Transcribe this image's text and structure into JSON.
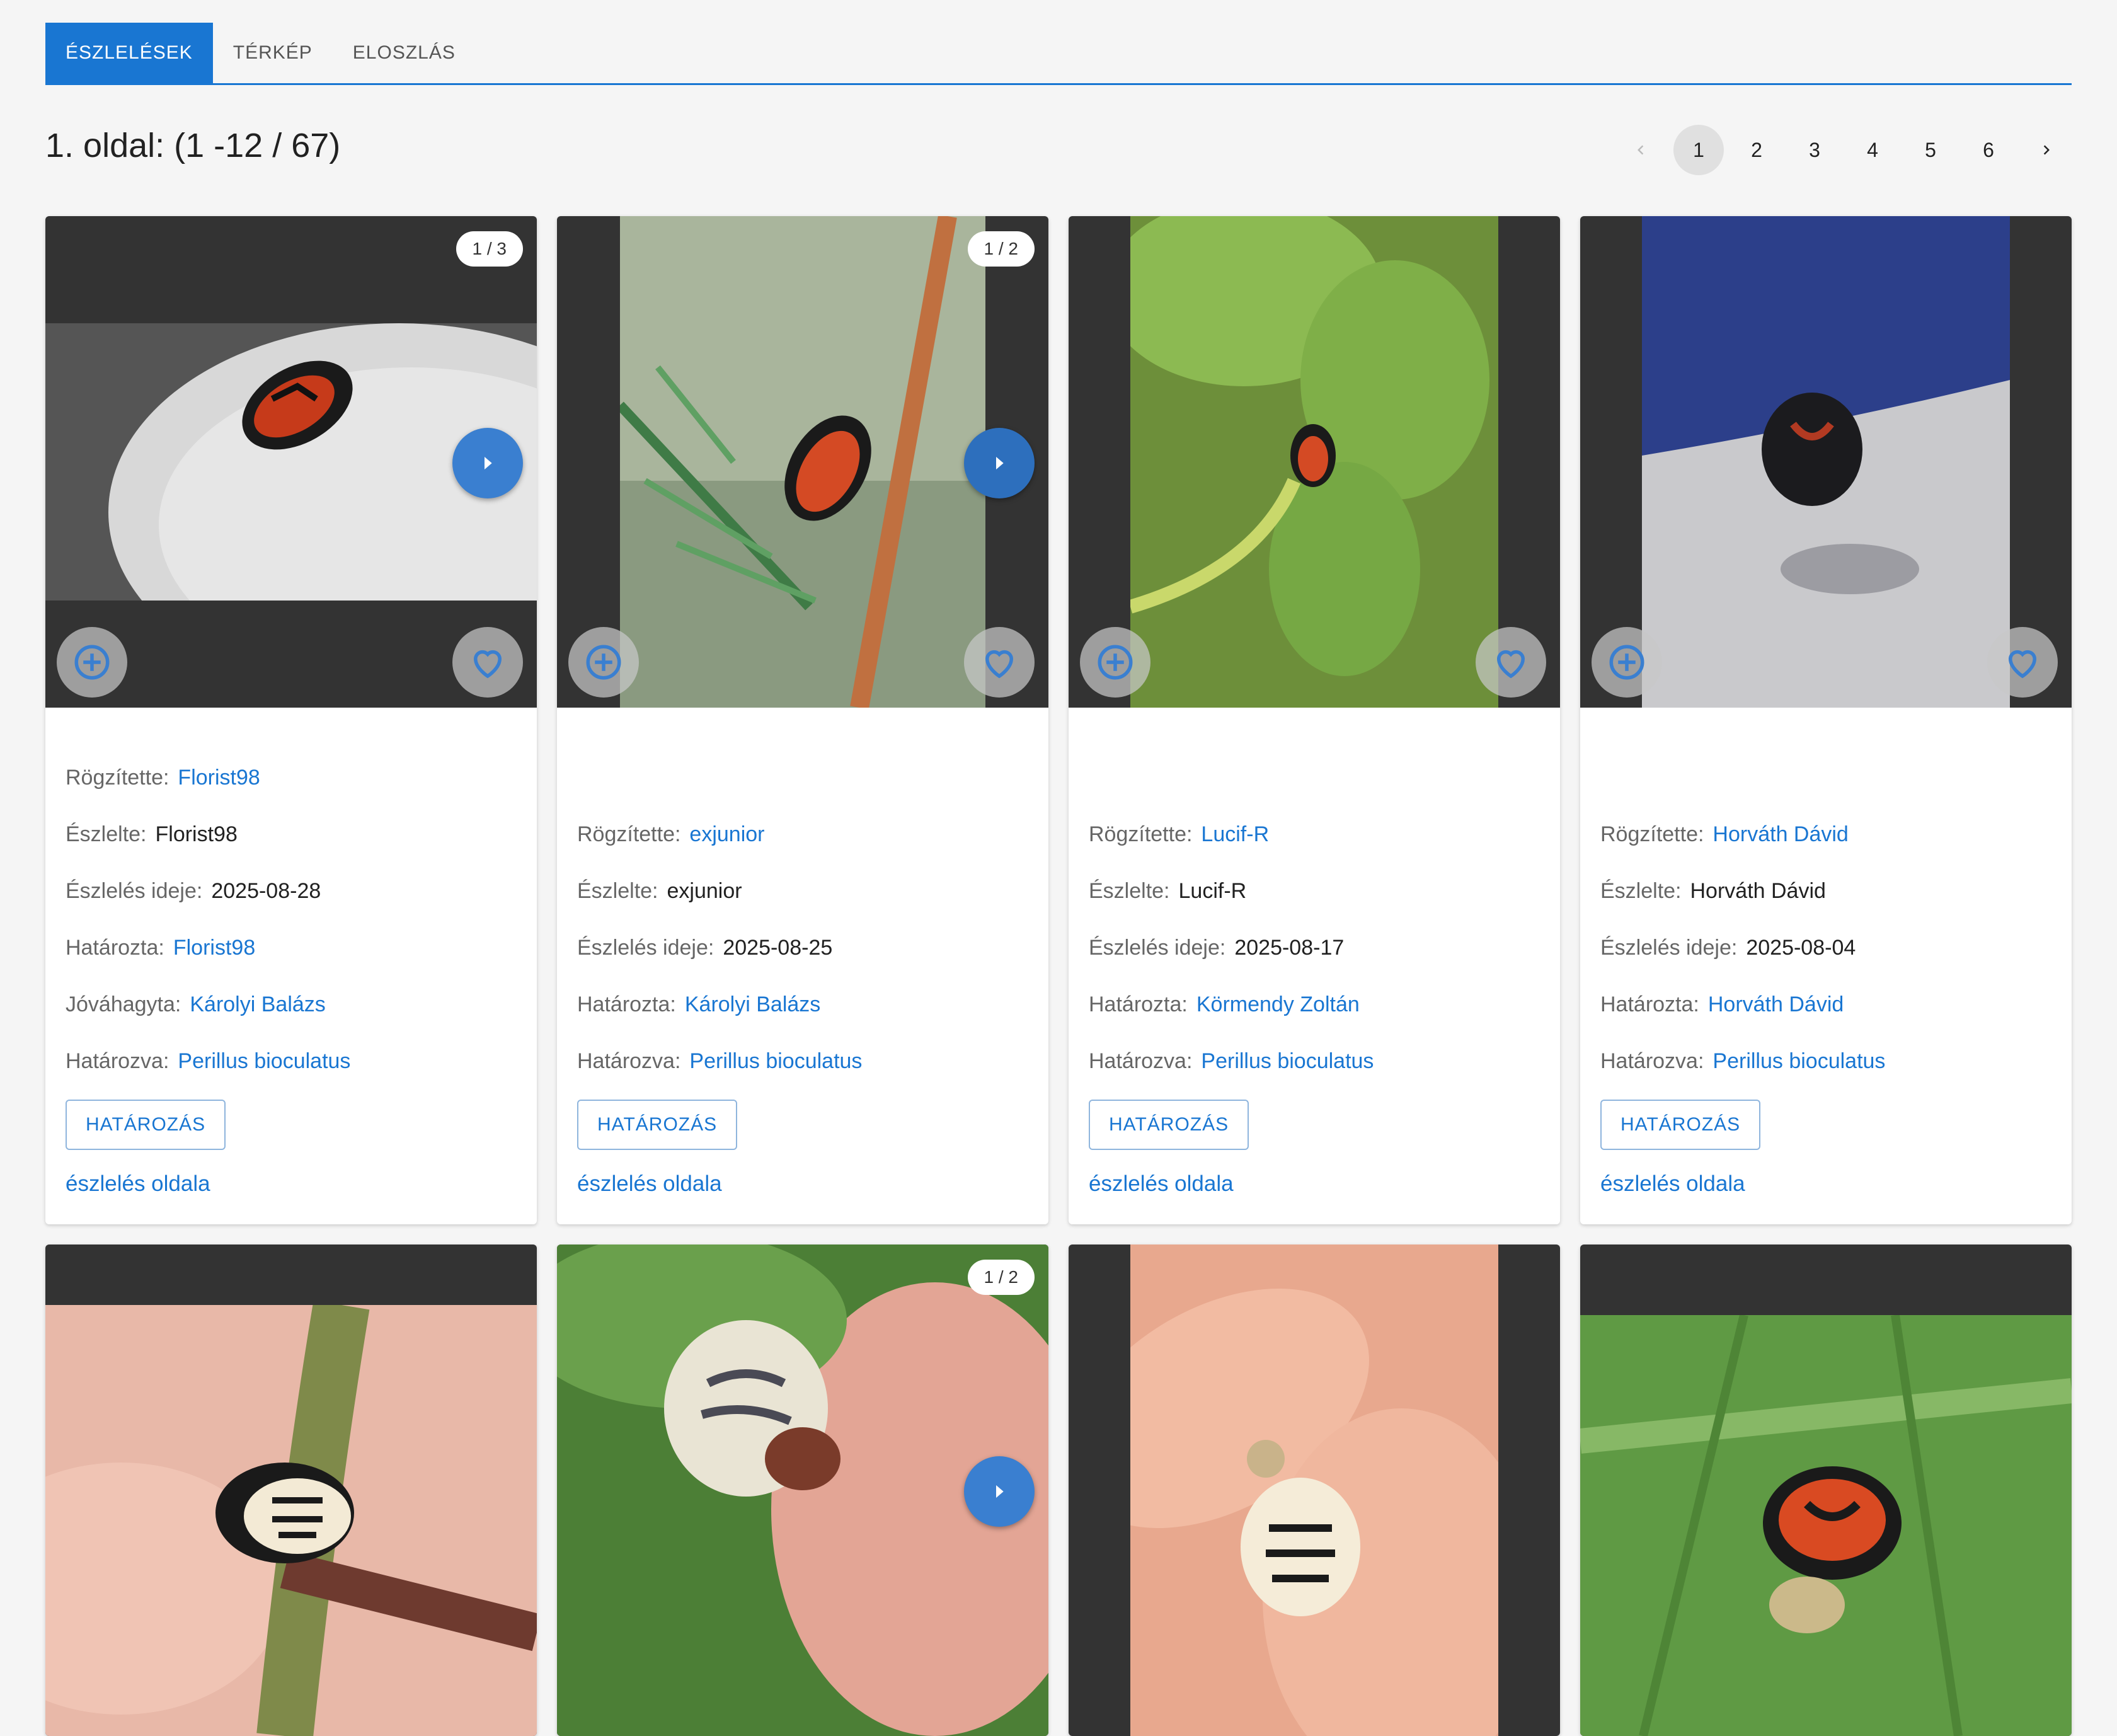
{
  "tabs": [
    {
      "label": "ÉSZLELÉSEK",
      "active": true
    },
    {
      "label": "TÉRKÉP",
      "active": false
    },
    {
      "label": "ELOSZLÁS",
      "active": false
    }
  ],
  "page_title": "1. oldal: (1 -12 / 67)",
  "pagination": {
    "pages": [
      "1",
      "2",
      "3",
      "4",
      "5",
      "6"
    ],
    "current": "1",
    "prev_icon": "chevron-left-icon",
    "next_icon": "chevron-right-icon"
  },
  "labels": {
    "recorded_by": "Rögzítette:",
    "observed_by": "Észlelte:",
    "observed_date": "Észlelés ideje:",
    "identified_by": "Határozta:",
    "approved_by": "Jóváhagyta:",
    "identified_as": "Határozva:",
    "identify_button": "HATÁROZÁS",
    "obs_page_link": "észlelés oldala"
  },
  "observations": [
    {
      "photo_count": "1 / 3",
      "recorded_by": "Florist98",
      "observed_by": "Florist98",
      "observed_date": "2025-08-28",
      "identified_by": "Florist98",
      "approved_by": "Károlyi Balázs",
      "identified_as": "Perillus bioculatus"
    },
    {
      "photo_count": "1 / 2",
      "recorded_by": "exjunior",
      "observed_by": "exjunior",
      "observed_date": "2025-08-25",
      "identified_by": "Károlyi Balázs",
      "identified_as": "Perillus bioculatus"
    },
    {
      "recorded_by": "Lucif-R",
      "observed_by": "Lucif-R",
      "observed_date": "2025-08-17",
      "identified_by": "Körmendy Zoltán",
      "identified_as": "Perillus bioculatus"
    },
    {
      "recorded_by": "Horváth Dávid",
      "observed_by": "Horváth Dávid",
      "observed_date": "2025-08-04",
      "identified_by": "Horváth Dávid",
      "identified_as": "Perillus bioculatus"
    },
    {},
    {
      "photo_count": "1 / 2"
    },
    {},
    {}
  ],
  "colors": {
    "accent": "#1976d2",
    "next_button": "#3a7fd0",
    "media_background": "#333333"
  }
}
